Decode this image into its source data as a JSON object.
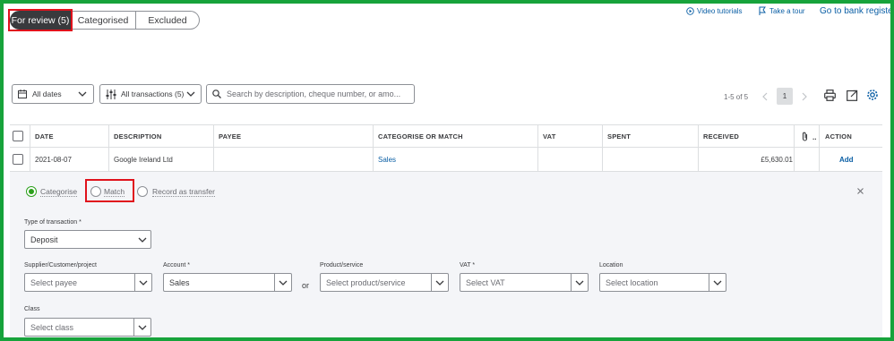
{
  "tabs": {
    "for_review": "For review (5)",
    "categorised": "Categorised",
    "excluded": "Excluded"
  },
  "top_links": {
    "video_tutorials": "Video tutorials",
    "take_a_tour": "Take a tour",
    "go_to_bank_register": "Go to bank registe"
  },
  "toolbar": {
    "dates_label": "All dates",
    "transactions_label": "All transactions (5)",
    "search_placeholder": "Search by description, cheque number, or amo...",
    "pagination_range": "1-5 of 5",
    "current_page": "1"
  },
  "table": {
    "headers": {
      "date": "DATE",
      "description": "DESCRIPTION",
      "payee": "PAYEE",
      "categorise_or_match": "CATEGORISE OR MATCH",
      "vat": "VAT",
      "spent": "SPENT",
      "received": "RECEIVED",
      "action": "ACTION"
    },
    "rows": [
      {
        "date": "2021-08-07",
        "description": "Google Ireland Ltd",
        "payee": "",
        "category": "Sales",
        "vat": "",
        "spent": "",
        "received": "£5,630.01",
        "action": "Add"
      }
    ]
  },
  "detail": {
    "mode_options": {
      "categorise": "Categorise",
      "match": "Match",
      "record_as_transfer": "Record as transfer"
    },
    "selected_mode": "Categorise",
    "type_label": "Type of transaction *",
    "type_value": "Deposit",
    "supplier_label": "Supplier/Customer/project",
    "supplier_placeholder": "Select payee",
    "account_label": "Account *",
    "account_value": "Sales",
    "or_label": "or",
    "product_label": "Product/service",
    "product_placeholder": "Select product/service",
    "vat_label": "VAT *",
    "vat_placeholder": "Select VAT",
    "location_label": "Location",
    "location_placeholder": "Select location",
    "class_label": "Class",
    "class_placeholder": "Select class"
  },
  "colors": {
    "frame_border": "#17a33b",
    "highlight_box": "#e0121c",
    "active_tab_bg": "#393a3d",
    "link_blue": "#0b5fa5",
    "radio_selected": "#2ca01c",
    "panel_bg": "#f4f5f8"
  },
  "icons": [
    "play-circle-icon",
    "tour-icon",
    "calendar-icon",
    "chevron-down-icon",
    "filter-sliders-icon",
    "search-icon",
    "chevron-left-icon",
    "chevron-right-icon",
    "print-icon",
    "export-icon",
    "gear-icon",
    "paperclip-icon",
    "close-icon"
  ]
}
